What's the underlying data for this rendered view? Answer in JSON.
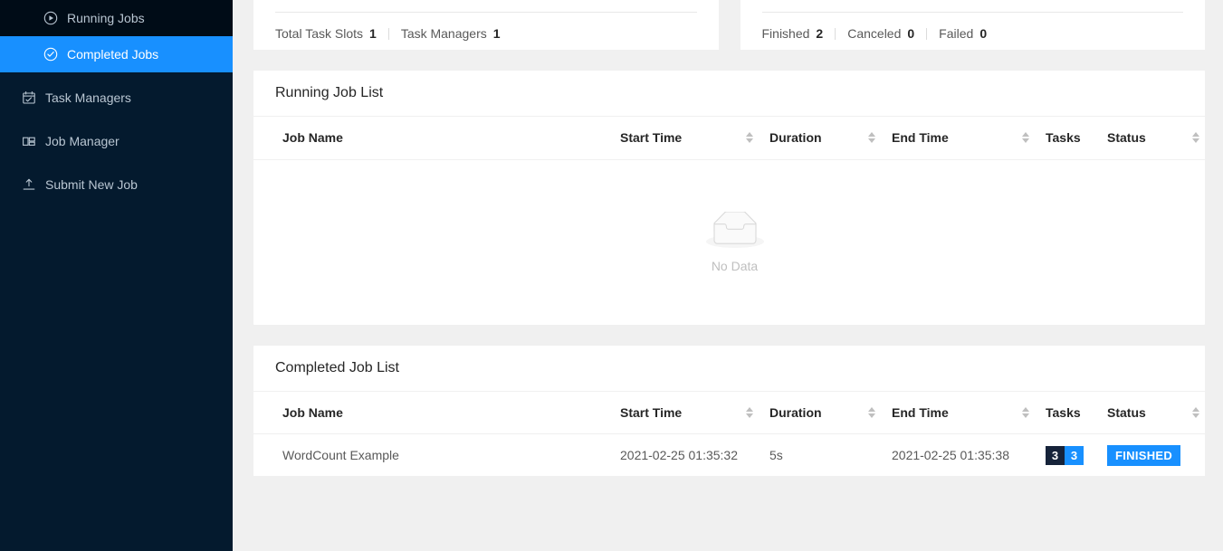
{
  "sidebar": {
    "items": [
      {
        "label": "Running Jobs",
        "icon": "play-circle-icon",
        "level": "sub",
        "active": false
      },
      {
        "label": "Completed Jobs",
        "icon": "check-circle-icon",
        "level": "sub",
        "active": true
      },
      {
        "label": "Task Managers",
        "icon": "schedule-icon",
        "level": "top",
        "active": false
      },
      {
        "label": "Job Manager",
        "icon": "dashboard-icon",
        "level": "top",
        "active": false
      },
      {
        "label": "Submit New Job",
        "icon": "upload-icon",
        "level": "top",
        "active": false
      }
    ]
  },
  "stats": {
    "left": [
      {
        "label": "Total Task Slots",
        "value": "1"
      },
      {
        "label": "Task Managers",
        "value": "1"
      }
    ],
    "right": [
      {
        "label": "Finished",
        "value": "2"
      },
      {
        "label": "Canceled",
        "value": "0"
      },
      {
        "label": "Failed",
        "value": "0"
      }
    ]
  },
  "running_list": {
    "title": "Running Job List",
    "columns": [
      {
        "label": "Job Name",
        "sortable": false
      },
      {
        "label": "Start Time",
        "sortable": true
      },
      {
        "label": "Duration",
        "sortable": true
      },
      {
        "label": "End Time",
        "sortable": true
      },
      {
        "label": "Tasks",
        "sortable": false
      },
      {
        "label": "Status",
        "sortable": true
      }
    ],
    "empty_text": "No Data",
    "rows": []
  },
  "completed_list": {
    "title": "Completed Job List",
    "columns": [
      {
        "label": "Job Name",
        "sortable": false
      },
      {
        "label": "Start Time",
        "sortable": true
      },
      {
        "label": "Duration",
        "sortable": true
      },
      {
        "label": "End Time",
        "sortable": true
      },
      {
        "label": "Tasks",
        "sortable": false
      },
      {
        "label": "Status",
        "sortable": true
      }
    ],
    "rows": [
      {
        "job_name": "WordCount Example",
        "start_time": "2021-02-25 01:35:32",
        "duration": "5s",
        "end_time": "2021-02-25 01:35:38",
        "tasks": [
          {
            "value": "3",
            "style": "dark"
          },
          {
            "value": "3",
            "style": "blue"
          }
        ],
        "status": "FINISHED"
      }
    ]
  },
  "colors": {
    "accent_blue": "#1890ff",
    "sidebar_bg": "#041a2e",
    "sidebar_sub_bg": "#000c17",
    "page_bg": "#f0f0f0",
    "badge_dark": "#16233a"
  }
}
